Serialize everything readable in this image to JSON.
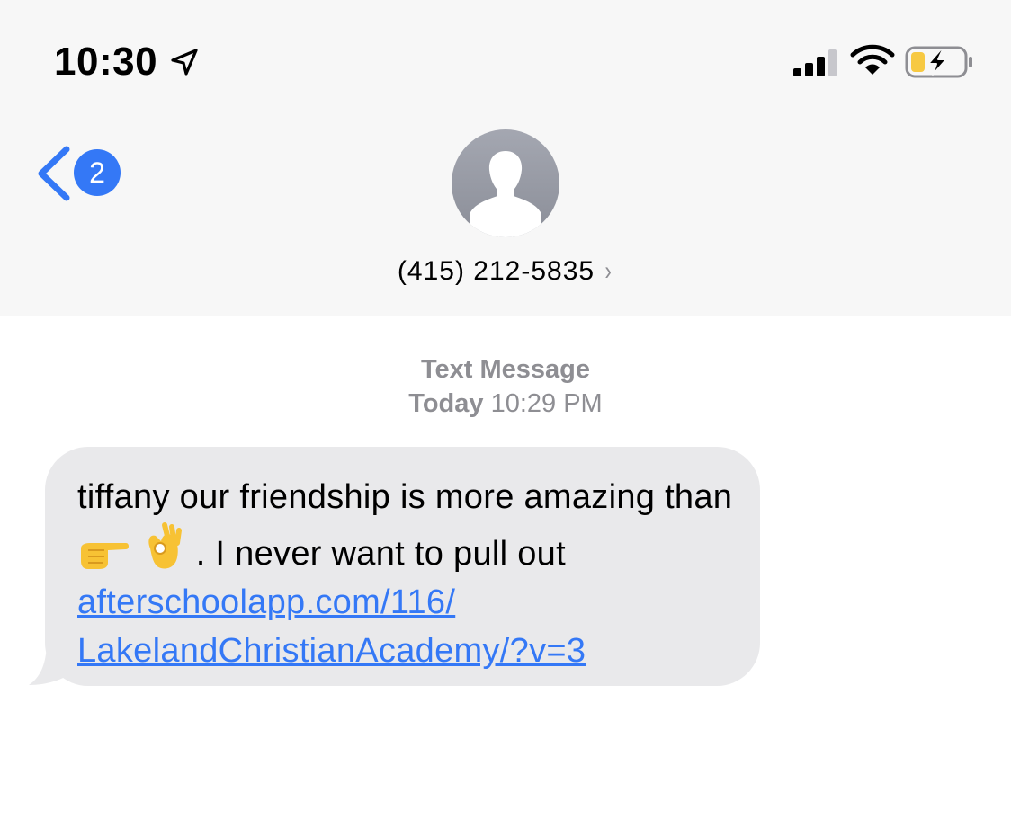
{
  "status_bar": {
    "time": "10:30",
    "icons": [
      "location-arrow-icon",
      "cellular-signal-icon",
      "wifi-icon",
      "battery-charging-icon"
    ]
  },
  "nav": {
    "back_badge_count": "2",
    "contact_number": "(415) 212-5835",
    "contact_chevron": "›"
  },
  "thread": {
    "service_label": "Text Message",
    "day_label": "Today",
    "time_label": "10:29 PM"
  },
  "message": {
    "text_before_emoji": "tiffany our friendship is more amazing than",
    "emojis": [
      "pointing-right-emoji",
      "ok-hand-emoji"
    ],
    "text_after_emoji": ". I never want to pull out",
    "link_line1": "afterschoolapp.com/116/",
    "link_line2": "LakelandChristianAcademy/?v=3"
  },
  "colors": {
    "accent": "#3478f6",
    "header_bg": "#f7f7f7",
    "bubble_bg": "#e9e9eb",
    "secondary_text": "#8e8e93",
    "battery_fill": "#f7c942"
  }
}
